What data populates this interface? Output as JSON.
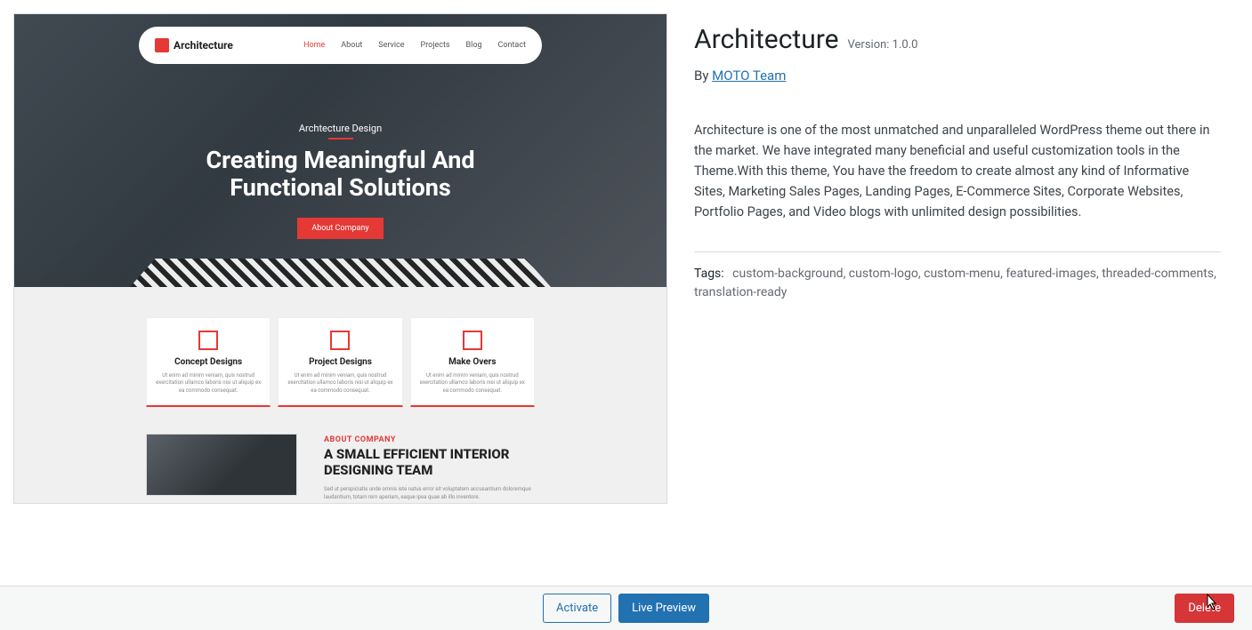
{
  "theme": {
    "title": "Architecture",
    "version_label": "Version: 1.0.0",
    "by_prefix": "By ",
    "author": "MOTO Team",
    "description": "Architecture is one of the most unmatched and unparalleled WordPress theme out there in the market. We have integrated many beneficial and useful customization tools in the Theme.With this theme, You have the freedom to create almost any kind of Informative Sites, Marketing Sales Pages, Landing Pages, E-Commerce Sites, Corporate Websites, Portfolio Pages, and Video blogs with unlimited design possibilities.",
    "tags_label": "Tags:",
    "tags": "custom-background, custom-logo, custom-menu, featured-images, threaded-comments, translation-ready"
  },
  "footer": {
    "activate": "Activate",
    "live_preview": "Live Preview",
    "delete": "Delete"
  },
  "preview": {
    "logo": "Architecture",
    "menu": {
      "home": "Home",
      "about": "About",
      "service": "Service",
      "projects": "Projects",
      "blog": "Blog",
      "contact": "Contact"
    },
    "hero_tag": "Archtecture Design",
    "hero_title_1": "Creating Meaningful And",
    "hero_title_2": "Functional Solutions",
    "hero_btn": "About Company",
    "cards": [
      {
        "title": "Concept Designs",
        "text": "Ut enim ad minim veniam, quis nostrud exercitation ullamco laboris nisi ut aliquip ex ea commodo consequat."
      },
      {
        "title": "Project Designs",
        "text": "Ut enim ad minim veniam, quis nostrud exercitation ullamco laboris nisi ut aliquip ex ea commodo consequat."
      },
      {
        "title": "Make Overs",
        "text": "Ut enim ad minim veniam, quis nostrud exercitation ullamco laboris nisi ut aliquip ex ea commodo consequat."
      }
    ],
    "about_label": "ABOUT COMPANY",
    "about_title_1": "A SMALL EFFICIENT INTERIOR",
    "about_title_2": "DESIGNING TEAM",
    "about_desc": "Sed ut perspiciatis unde omnis iste natus error sit voluptatem accusantium doloremque laudantium, totam rem aperiam, eaque ipsa quae ab illo inventore."
  }
}
